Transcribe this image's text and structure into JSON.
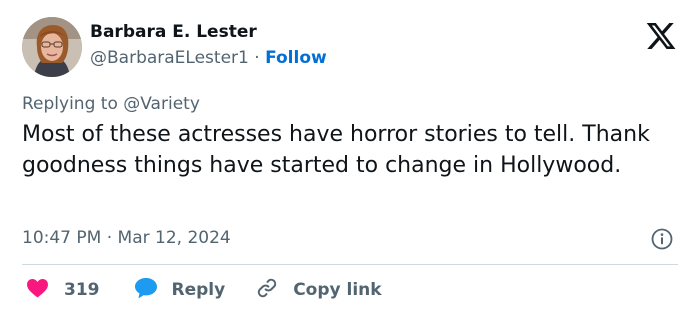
{
  "author": {
    "name": "Barbara E. Lester",
    "handle": "@BarbaraELester1",
    "separator": "·",
    "follow_label": "Follow"
  },
  "reply": {
    "prefix": "Replying to",
    "target": "@Variety"
  },
  "tweet": {
    "text": "Most of these actresses have horror stories to tell. Thank goodness things have started to change in Hollywood.",
    "timestamp": "10:47 PM · Mar 12, 2024"
  },
  "actions": {
    "like_count": "319",
    "reply_label": "Reply",
    "copy_label": "Copy link"
  },
  "colors": {
    "text": "#0f1419",
    "secondary": "#536471",
    "link": "#006fd6",
    "like": "#f91880",
    "reply_icon": "#1d9bf0",
    "divider": "#cfd9de"
  },
  "icons": {
    "platform": "x-logo-icon",
    "info": "info-icon",
    "like": "heart-icon",
    "reply": "speech-bubble-icon",
    "copy": "link-icon"
  }
}
